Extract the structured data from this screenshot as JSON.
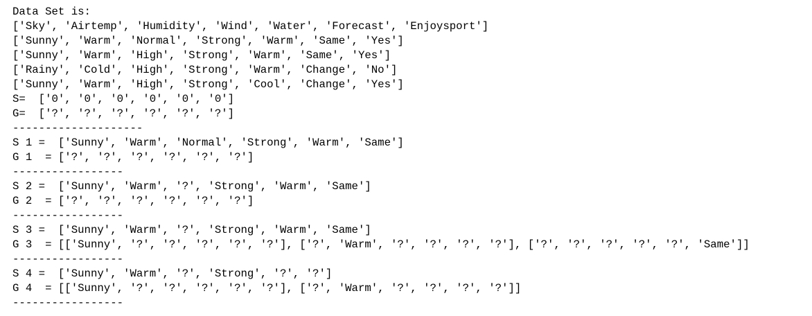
{
  "output": {
    "lines": [
      "Data Set is:",
      "['Sky', 'Airtemp', 'Humidity', 'Wind', 'Water', 'Forecast', 'Enjoysport']",
      "['Sunny', 'Warm', 'Normal', 'Strong', 'Warm', 'Same', 'Yes']",
      "['Sunny', 'Warm', 'High', 'Strong', 'Warm', 'Same', 'Yes']",
      "['Rainy', 'Cold', 'High', 'Strong', 'Warm', 'Change', 'No']",
      "['Sunny', 'Warm', 'High', 'Strong', 'Cool', 'Change', 'Yes']",
      "S=  ['0', '0', '0', '0', '0', '0']",
      "G=  ['?', '?', '?', '?', '?', '?']",
      "--------------------",
      "S 1 =  ['Sunny', 'Warm', 'Normal', 'Strong', 'Warm', 'Same']",
      "G 1  = ['?', '?', '?', '?', '?', '?']",
      "-----------------",
      "S 2 =  ['Sunny', 'Warm', '?', 'Strong', 'Warm', 'Same']",
      "G 2  = ['?', '?', '?', '?', '?', '?']",
      "-----------------",
      "S 3 =  ['Sunny', 'Warm', '?', 'Strong', 'Warm', 'Same']",
      "G 3  = [['Sunny', '?', '?', '?', '?', '?'], ['?', 'Warm', '?', '?', '?', '?'], ['?', '?', '?', '?', '?', 'Same']]",
      "-----------------",
      "S 4 =  ['Sunny', 'Warm', '?', 'Strong', '?', '?']",
      "G 4  = [['Sunny', '?', '?', '?', '?', '?'], ['?', 'Warm', '?', '?', '?', '?']]",
      "-----------------"
    ]
  }
}
